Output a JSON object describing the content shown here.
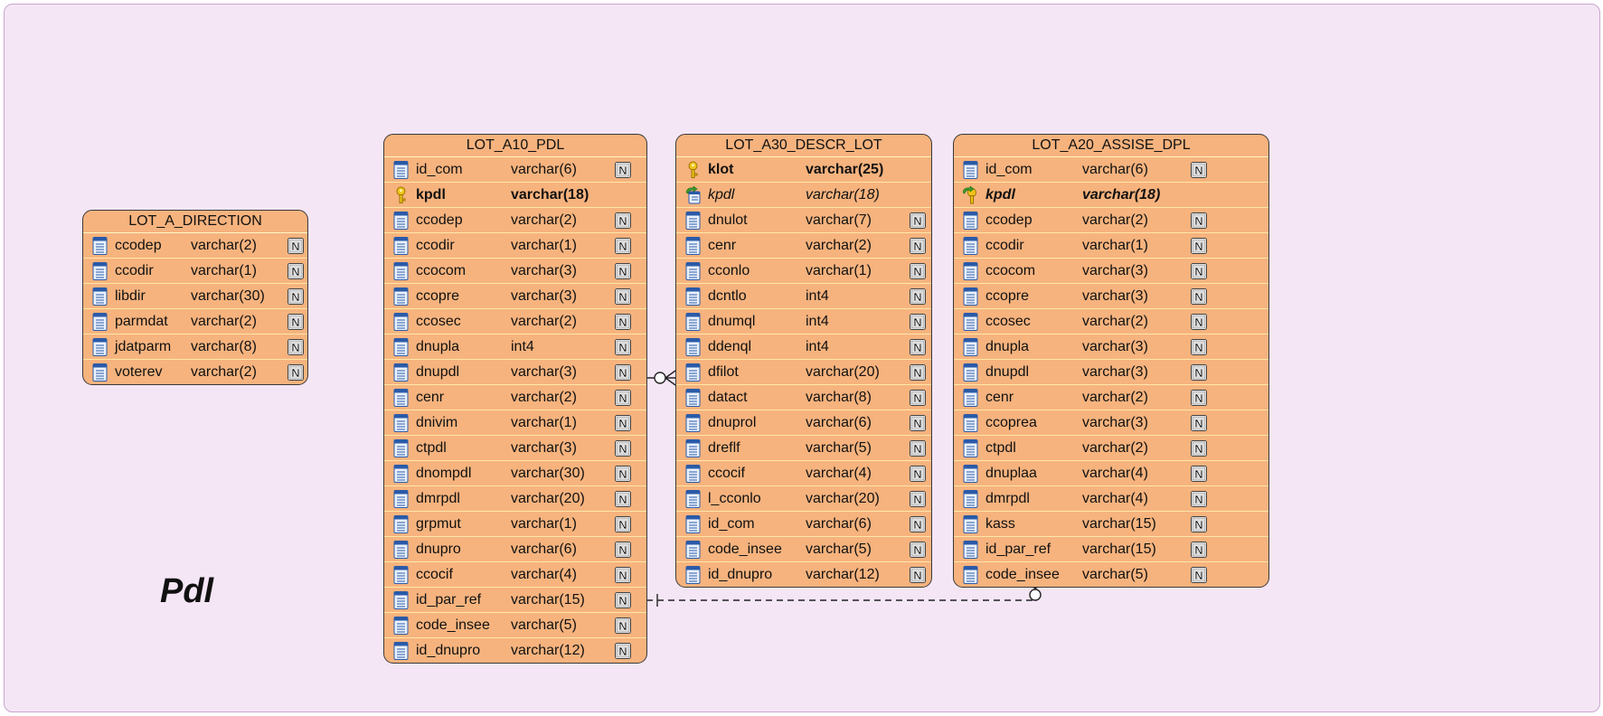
{
  "group_label": "Pdl",
  "entities": [
    {
      "id": "lot-a-direction",
      "name": "LOT_A_DIRECTION",
      "columns": [
        {
          "name": "ccodep",
          "type": "varchar(2)",
          "key": "",
          "nullable": true
        },
        {
          "name": "ccodir",
          "type": "varchar(1)",
          "key": "",
          "nullable": true
        },
        {
          "name": "libdir",
          "type": "varchar(30)",
          "key": "",
          "nullable": true
        },
        {
          "name": "parmdat",
          "type": "varchar(2)",
          "key": "",
          "nullable": true
        },
        {
          "name": "jdatparm",
          "type": "varchar(8)",
          "key": "",
          "nullable": true
        },
        {
          "name": "voterev",
          "type": "varchar(2)",
          "key": "",
          "nullable": true
        }
      ]
    },
    {
      "id": "lot-a10-pdl",
      "name": "LOT_A10_PDL",
      "columns": [
        {
          "name": "id_com",
          "type": "varchar(6)",
          "key": "",
          "nullable": true
        },
        {
          "name": "kpdl",
          "type": "varchar(18)",
          "key": "pk",
          "nullable": false
        },
        {
          "name": "ccodep",
          "type": "varchar(2)",
          "key": "",
          "nullable": true
        },
        {
          "name": "ccodir",
          "type": "varchar(1)",
          "key": "",
          "nullable": true
        },
        {
          "name": "ccocom",
          "type": "varchar(3)",
          "key": "",
          "nullable": true
        },
        {
          "name": "ccopre",
          "type": "varchar(3)",
          "key": "",
          "nullable": true
        },
        {
          "name": "ccosec",
          "type": "varchar(2)",
          "key": "",
          "nullable": true
        },
        {
          "name": "dnupla",
          "type": "int4",
          "key": "",
          "nullable": true
        },
        {
          "name": "dnupdl",
          "type": "varchar(3)",
          "key": "",
          "nullable": true
        },
        {
          "name": "cenr",
          "type": "varchar(2)",
          "key": "",
          "nullable": true
        },
        {
          "name": "dnivim",
          "type": "varchar(1)",
          "key": "",
          "nullable": true
        },
        {
          "name": "ctpdl",
          "type": "varchar(3)",
          "key": "",
          "nullable": true
        },
        {
          "name": "dnompdl",
          "type": "varchar(30)",
          "key": "",
          "nullable": true
        },
        {
          "name": "dmrpdl",
          "type": "varchar(20)",
          "key": "",
          "nullable": true
        },
        {
          "name": "grpmut",
          "type": "varchar(1)",
          "key": "",
          "nullable": true
        },
        {
          "name": "dnupro",
          "type": "varchar(6)",
          "key": "",
          "nullable": true
        },
        {
          "name": "ccocif",
          "type": "varchar(4)",
          "key": "",
          "nullable": true
        },
        {
          "name": "id_par_ref",
          "type": "varchar(15)",
          "key": "",
          "nullable": true
        },
        {
          "name": "code_insee",
          "type": "varchar(5)",
          "key": "",
          "nullable": true
        },
        {
          "name": "id_dnupro",
          "type": "varchar(12)",
          "key": "",
          "nullable": true
        }
      ]
    },
    {
      "id": "lot-a30-descr-lot",
      "name": "LOT_A30_DESCR_LOT",
      "columns": [
        {
          "name": "klot",
          "type": "varchar(25)",
          "key": "pk",
          "nullable": false
        },
        {
          "name": "kpdl",
          "type": "varchar(18)",
          "key": "fk",
          "nullable": false
        },
        {
          "name": "dnulot",
          "type": "varchar(7)",
          "key": "",
          "nullable": true
        },
        {
          "name": "cenr",
          "type": "varchar(2)",
          "key": "",
          "nullable": true
        },
        {
          "name": "cconlo",
          "type": "varchar(1)",
          "key": "",
          "nullable": true
        },
        {
          "name": "dcntlo",
          "type": "int4",
          "key": "",
          "nullable": true
        },
        {
          "name": "dnumql",
          "type": "int4",
          "key": "",
          "nullable": true
        },
        {
          "name": "ddenql",
          "type": "int4",
          "key": "",
          "nullable": true
        },
        {
          "name": "dfilot",
          "type": "varchar(20)",
          "key": "",
          "nullable": true
        },
        {
          "name": "datact",
          "type": "varchar(8)",
          "key": "",
          "nullable": true
        },
        {
          "name": "dnuprol",
          "type": "varchar(6)",
          "key": "",
          "nullable": true
        },
        {
          "name": "dreflf",
          "type": "varchar(5)",
          "key": "",
          "nullable": true
        },
        {
          "name": "ccocif",
          "type": "varchar(4)",
          "key": "",
          "nullable": true
        },
        {
          "name": "l_cconlo",
          "type": "varchar(20)",
          "key": "",
          "nullable": true
        },
        {
          "name": "id_com",
          "type": "varchar(6)",
          "key": "",
          "nullable": true
        },
        {
          "name": "code_insee",
          "type": "varchar(5)",
          "key": "",
          "nullable": true
        },
        {
          "name": "id_dnupro",
          "type": "varchar(12)",
          "key": "",
          "nullable": true
        }
      ]
    },
    {
      "id": "lot-a20-assise-dpl",
      "name": "LOT_A20_ASSISE_DPL",
      "columns": [
        {
          "name": "id_com",
          "type": "varchar(6)",
          "key": "",
          "nullable": true
        },
        {
          "name": "kpdl",
          "type": "varchar(18)",
          "key": "pkfk",
          "nullable": false
        },
        {
          "name": "ccodep",
          "type": "varchar(2)",
          "key": "",
          "nullable": true
        },
        {
          "name": "ccodir",
          "type": "varchar(1)",
          "key": "",
          "nullable": true
        },
        {
          "name": "ccocom",
          "type": "varchar(3)",
          "key": "",
          "nullable": true
        },
        {
          "name": "ccopre",
          "type": "varchar(3)",
          "key": "",
          "nullable": true
        },
        {
          "name": "ccosec",
          "type": "varchar(2)",
          "key": "",
          "nullable": true
        },
        {
          "name": "dnupla",
          "type": "varchar(3)",
          "key": "",
          "nullable": true
        },
        {
          "name": "dnupdl",
          "type": "varchar(3)",
          "key": "",
          "nullable": true
        },
        {
          "name": "cenr",
          "type": "varchar(2)",
          "key": "",
          "nullable": true
        },
        {
          "name": "ccoprea",
          "type": "varchar(3)",
          "key": "",
          "nullable": true
        },
        {
          "name": "ctpdl",
          "type": "varchar(2)",
          "key": "",
          "nullable": true
        },
        {
          "name": "dnuplaa",
          "type": "varchar(4)",
          "key": "",
          "nullable": true
        },
        {
          "name": "dmrpdl",
          "type": "varchar(4)",
          "key": "",
          "nullable": true
        },
        {
          "name": "kass",
          "type": "varchar(15)",
          "key": "",
          "nullable": true
        },
        {
          "name": "id_par_ref",
          "type": "varchar(15)",
          "key": "",
          "nullable": true
        },
        {
          "name": "code_insee",
          "type": "varchar(5)",
          "key": "",
          "nullable": true
        }
      ]
    }
  ],
  "relationships": [
    {
      "from": "LOT_A10_PDL",
      "to": "LOT_A30_DESCR_LOT",
      "cardinality": "one-to-zero-or-many",
      "style": "solid"
    },
    {
      "from": "LOT_A10_PDL",
      "to": "LOT_A20_ASSISE_DPL",
      "cardinality": "one-to-zero-or-many",
      "style": "dashed"
    }
  ],
  "colors": {
    "canvas": "#f5e6f6",
    "entity_fill": "#f6b37e",
    "row_separator": "#ffe7a8",
    "border": "#3a3a3a",
    "connector": "#222222"
  }
}
